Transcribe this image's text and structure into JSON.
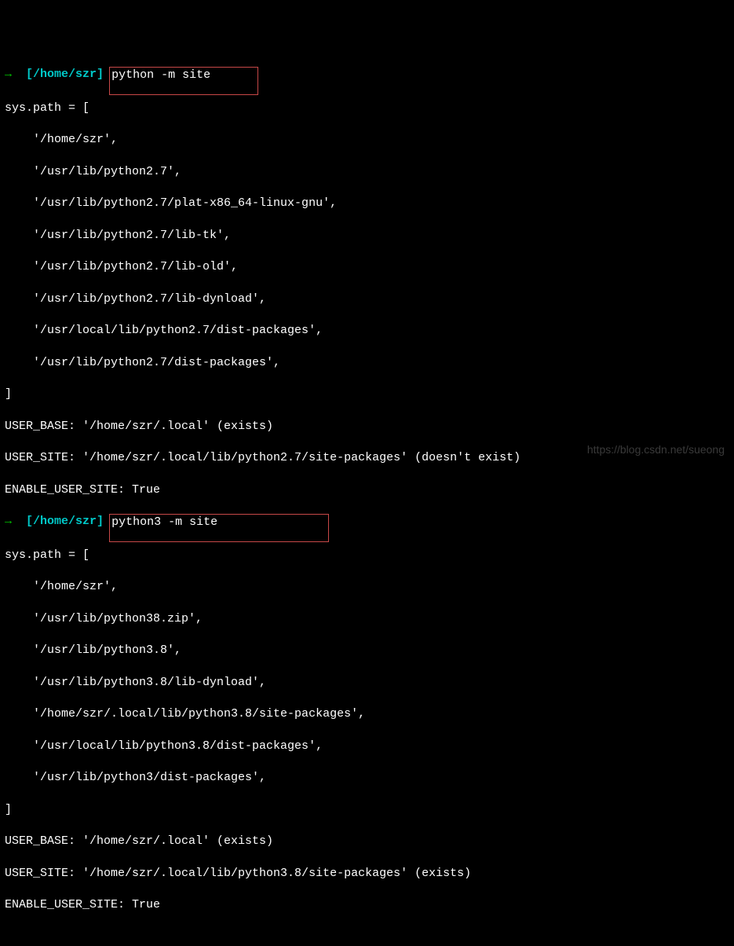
{
  "block1": {
    "prompt_arrow": "→",
    "prompt_path": "[/home/szr]",
    "command": "python -m site",
    "syspath_open": "sys.path = [",
    "paths": [
      "    '/home/szr',",
      "    '/usr/lib/python2.7',",
      "    '/usr/lib/python2.7/plat-x86_64-linux-gnu',",
      "    '/usr/lib/python2.7/lib-tk',",
      "    '/usr/lib/python2.7/lib-old',",
      "    '/usr/lib/python2.7/lib-dynload',",
      "    '/usr/local/lib/python2.7/dist-packages',",
      "    '/usr/lib/python2.7/dist-packages',"
    ],
    "syspath_close": "]",
    "user_base": "USER_BASE: '/home/szr/.local' (exists)",
    "user_site": "USER_SITE: '/home/szr/.local/lib/python2.7/site-packages' (doesn't exist)",
    "enable": "ENABLE_USER_SITE: True"
  },
  "block2": {
    "prompt_arrow": "→",
    "prompt_path": "[/home/szr]",
    "command": "python3 -m site",
    "syspath_open": "sys.path = [",
    "paths": [
      "    '/home/szr',",
      "    '/usr/lib/python38.zip',",
      "    '/usr/lib/python3.8',",
      "    '/usr/lib/python3.8/lib-dynload',",
      "    '/home/szr/.local/lib/python3.8/site-packages',",
      "    '/usr/local/lib/python3.8/dist-packages',",
      "    '/usr/lib/python3/dist-packages',"
    ],
    "syspath_close": "]",
    "user_base": "USER_BASE: '/home/szr/.local' (exists)",
    "user_site": "USER_SITE: '/home/szr/.local/lib/python3.8/site-packages' (exists)",
    "enable": "ENABLE_USER_SITE: True"
  },
  "watermark": "https://blog.csdn.net/sueong"
}
